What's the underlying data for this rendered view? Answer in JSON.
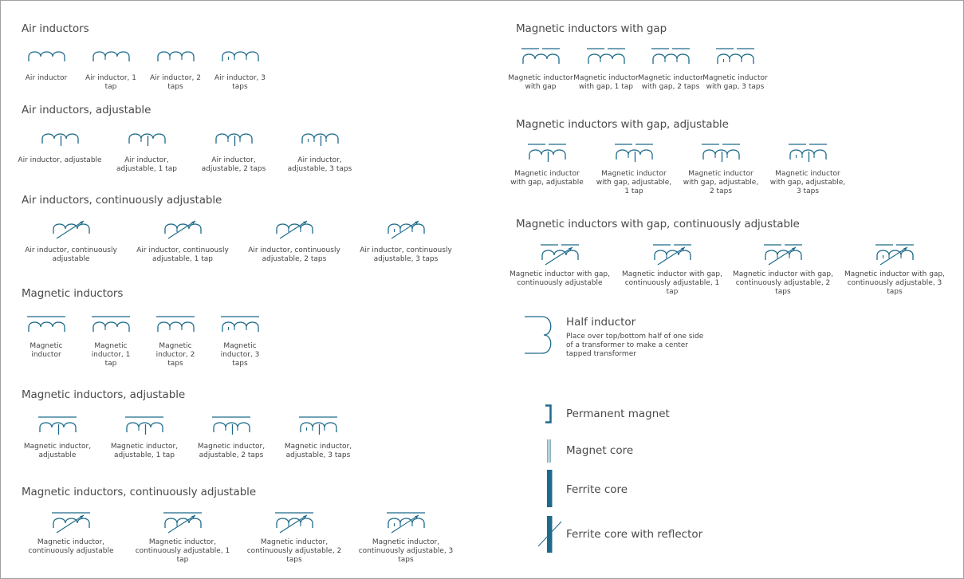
{
  "accent_color": "#1d6a8a",
  "sections": [
    {
      "title": "Air inductors",
      "items": [
        {
          "label": "Air inductor",
          "core": "none",
          "taps": 0,
          "adjust": "none"
        },
        {
          "label": "Air inductor, 1\ntap",
          "core": "none",
          "taps": 1,
          "adjust": "none"
        },
        {
          "label": "Air inductor, 2\ntaps",
          "core": "none",
          "taps": 2,
          "adjust": "none"
        },
        {
          "label": "Air inductor, 3\ntaps",
          "core": "none",
          "taps": 3,
          "adjust": "none"
        }
      ]
    },
    {
      "title": "Air inductors, adjustable",
      "items": [
        {
          "label": "Air inductor, adjustable",
          "core": "none",
          "taps": 0,
          "adjust": "tap"
        },
        {
          "label": "Air inductor,\nadjustable, 1 tap",
          "core": "none",
          "taps": 1,
          "adjust": "tap"
        },
        {
          "label": "Air inductor,\nadjustable, 2 taps",
          "core": "none",
          "taps": 2,
          "adjust": "tap"
        },
        {
          "label": "Air inductor,\nadjustable, 3 taps",
          "core": "none",
          "taps": 3,
          "adjust": "tap"
        }
      ]
    },
    {
      "title": "Air inductors, continuously adjustable",
      "items": [
        {
          "label": "Air inductor, continuously\nadjustable",
          "core": "none",
          "taps": 0,
          "adjust": "arrow"
        },
        {
          "label": "Air inductor, continuously\nadjustable, 1 tap",
          "core": "none",
          "taps": 1,
          "adjust": "arrow"
        },
        {
          "label": "Air inductor, continuously\nadjustable, 2 taps",
          "core": "none",
          "taps": 2,
          "adjust": "arrow"
        },
        {
          "label": "Air inductor, continuously\nadjustable, 3 taps",
          "core": "none",
          "taps": 3,
          "adjust": "arrow"
        }
      ]
    },
    {
      "title": "Magnetic inductors",
      "items": [
        {
          "label": "Magnetic\ninductor",
          "core": "line",
          "taps": 0,
          "adjust": "none"
        },
        {
          "label": "Magnetic\ninductor, 1\ntap",
          "core": "line",
          "taps": 1,
          "adjust": "none"
        },
        {
          "label": "Magnetic\ninductor, 2\ntaps",
          "core": "line",
          "taps": 2,
          "adjust": "none"
        },
        {
          "label": "Magnetic\ninductor, 3\ntaps",
          "core": "line",
          "taps": 3,
          "adjust": "none"
        }
      ]
    },
    {
      "title": "Magnetic inductors, adjustable",
      "items": [
        {
          "label": "Magnetic inductor,\nadjustable",
          "core": "line",
          "taps": 0,
          "adjust": "tap"
        },
        {
          "label": "Magnetic inductor,\nadjustable, 1 tap",
          "core": "line",
          "taps": 1,
          "adjust": "tap"
        },
        {
          "label": "Magnetic inductor,\nadjustable, 2 taps",
          "core": "line",
          "taps": 2,
          "adjust": "tap"
        },
        {
          "label": "Magnetic inductor,\nadjustable, 3 taps",
          "core": "line",
          "taps": 3,
          "adjust": "tap"
        }
      ]
    },
    {
      "title": "Magnetic inductors, continuously adjustable",
      "items": [
        {
          "label": "Magnetic inductor,\ncontinuously adjustable",
          "core": "line",
          "taps": 0,
          "adjust": "arrow"
        },
        {
          "label": "Magnetic inductor,\ncontinuously adjustable, 1 tap",
          "core": "line",
          "taps": 1,
          "adjust": "arrow"
        },
        {
          "label": "Magnetic inductor,\ncontinuously adjustable, 2\ntaps",
          "core": "line",
          "taps": 2,
          "adjust": "arrow"
        },
        {
          "label": "Magnetic inductor,\ncontinuously adjustable, 3\ntaps",
          "core": "line",
          "taps": 3,
          "adjust": "arrow"
        }
      ]
    },
    {
      "title": "Magnetic inductors with gap",
      "items": [
        {
          "label": "Magnetic inductor\nwith gap",
          "core": "gap",
          "taps": 0,
          "adjust": "none"
        },
        {
          "label": "Magnetic inductor\nwith gap, 1 tap",
          "core": "gap",
          "taps": 1,
          "adjust": "none"
        },
        {
          "label": "Magnetic inductor\nwith gap, 2 taps",
          "core": "gap",
          "taps": 2,
          "adjust": "none"
        },
        {
          "label": "Magnetic inductor\nwith gap, 3 taps",
          "core": "gap",
          "taps": 3,
          "adjust": "none"
        }
      ]
    },
    {
      "title": "Magnetic inductors with gap, adjustable",
      "items": [
        {
          "label": "Magnetic inductor\nwith gap, adjustable",
          "core": "gap",
          "taps": 0,
          "adjust": "tap"
        },
        {
          "label": "Magnetic inductor\nwith gap, adjustable,\n1 tap",
          "core": "gap",
          "taps": 1,
          "adjust": "tap"
        },
        {
          "label": "Magnetic inductor\nwith gap, adjustable,\n2 taps",
          "core": "gap",
          "taps": 2,
          "adjust": "tap"
        },
        {
          "label": "Magnetic inductor\nwith gap, adjustable,\n3 taps",
          "core": "gap",
          "taps": 3,
          "adjust": "tap"
        }
      ]
    },
    {
      "title": "Magnetic inductors with gap, continuously adjustable",
      "items": [
        {
          "label": "Magnetic inductor with gap,\ncontinuously adjustable",
          "core": "gap",
          "taps": 0,
          "adjust": "arrow"
        },
        {
          "label": "Magnetic inductor with gap,\ncontinuously adjustable, 1 tap",
          "core": "gap",
          "taps": 1,
          "adjust": "arrow"
        },
        {
          "label": "Magnetic inductor with gap,\ncontinuously adjustable, 2\ntaps",
          "core": "gap",
          "taps": 2,
          "adjust": "arrow"
        },
        {
          "label": "Magnetic inductor with gap,\ncontinuously adjustable, 3\ntaps",
          "core": "gap",
          "taps": 3,
          "adjust": "arrow"
        }
      ]
    }
  ],
  "half_inductor": {
    "title": "Half inductor",
    "description": "Place over top/bottom half of one side of a transformer to make a center tapped transformer"
  },
  "cores": [
    {
      "title": "Permanent magnet",
      "icon": "permanent-magnet"
    },
    {
      "title": "Magnet core",
      "icon": "magnet-core"
    },
    {
      "title": "Ferrite core",
      "icon": "ferrite-core"
    },
    {
      "title": "Ferrite core with reflector",
      "icon": "ferrite-core-reflector"
    }
  ]
}
